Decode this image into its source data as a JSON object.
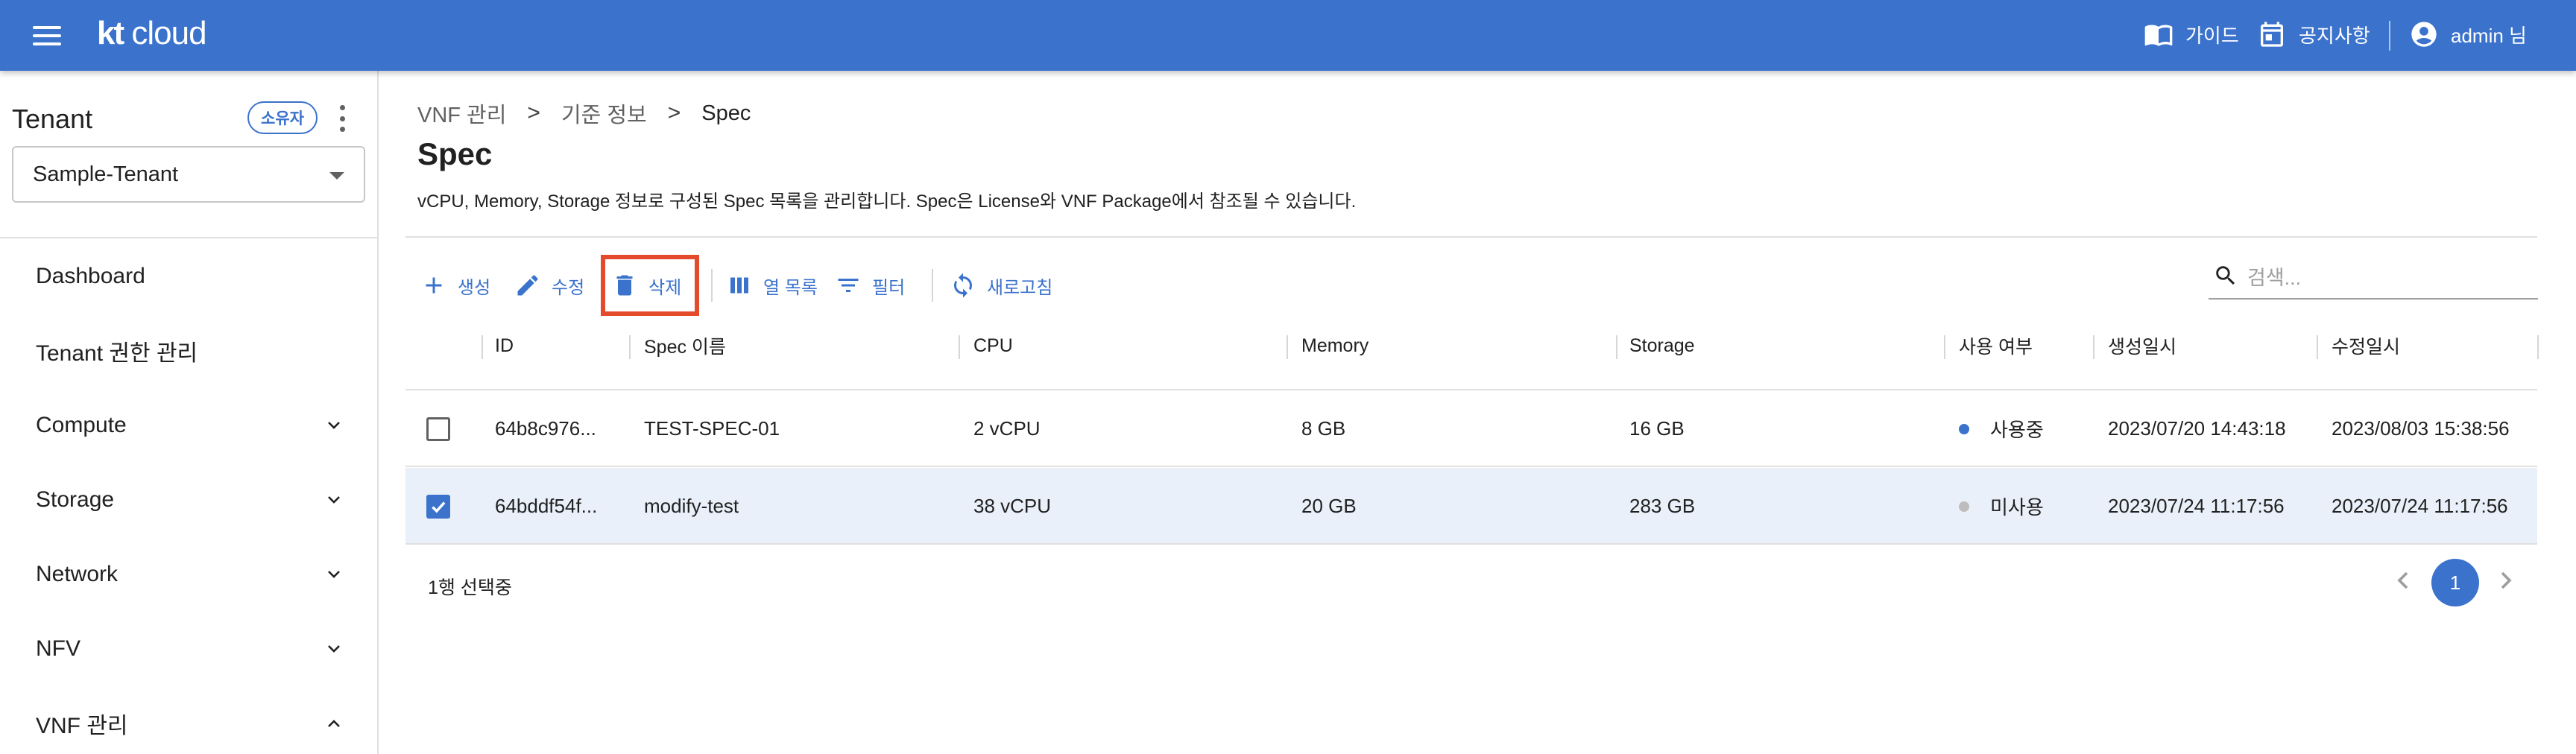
{
  "header": {
    "logo_brand": "kt",
    "logo_text": " cloud",
    "guide_label": "가이드",
    "notice_label": "공지사항",
    "user_label": "admin 님"
  },
  "sidebar": {
    "tenant_title": "Tenant",
    "owner_chip": "소유자",
    "tenant_selected": "Sample-Tenant",
    "items": [
      {
        "label": "Dashboard"
      },
      {
        "label": "Tenant 권한 관리"
      },
      {
        "label": "Compute"
      },
      {
        "label": "Storage"
      },
      {
        "label": "Network"
      },
      {
        "label": "NFV"
      },
      {
        "label": "VNF 관리"
      }
    ]
  },
  "breadcrumb": {
    "items": [
      "VNF 관리",
      "기준 정보",
      "Spec"
    ],
    "separator": ">"
  },
  "page": {
    "title": "Spec",
    "description": "vCPU, Memory, Storage 정보로 구성된 Spec 목록을 관리합니다. Spec은 License와 VNF Package에서 참조될 수 있습니다."
  },
  "toolbar": {
    "create": "생성",
    "edit": "수정",
    "delete": "삭제",
    "columns": "열 목록",
    "filter": "필터",
    "refresh": "새로고침",
    "search_placeholder": "검색..."
  },
  "table": {
    "columns": [
      "ID",
      "Spec 이름",
      "CPU",
      "Memory",
      "Storage",
      "사용 여부",
      "생성일시",
      "수정일시"
    ],
    "rows": [
      {
        "checked": false,
        "id": "64b8c976...",
        "name": "TEST-SPEC-01",
        "cpu": "2 vCPU",
        "memory": "8 GB",
        "storage": "16 GB",
        "status": "사용중",
        "status_color": "#3a72cc",
        "created": "2023/07/20 14:43:18",
        "modified": "2023/08/03 15:38:56"
      },
      {
        "checked": true,
        "id": "64bddf54f...",
        "name": "modify-test",
        "cpu": "38 vCPU",
        "memory": "20 GB",
        "storage": "283 GB",
        "status": "미사용",
        "status_color": "#bdbdbd",
        "created": "2023/07/24 11:17:56",
        "modified": "2023/07/24 11:17:56"
      }
    ]
  },
  "footer": {
    "selection_text": "1행 선택중",
    "current_page": "1"
  },
  "colors": {
    "primary": "#3a72cc",
    "highlight": "#e34b2c",
    "selected_row": "#eaf0fa"
  }
}
